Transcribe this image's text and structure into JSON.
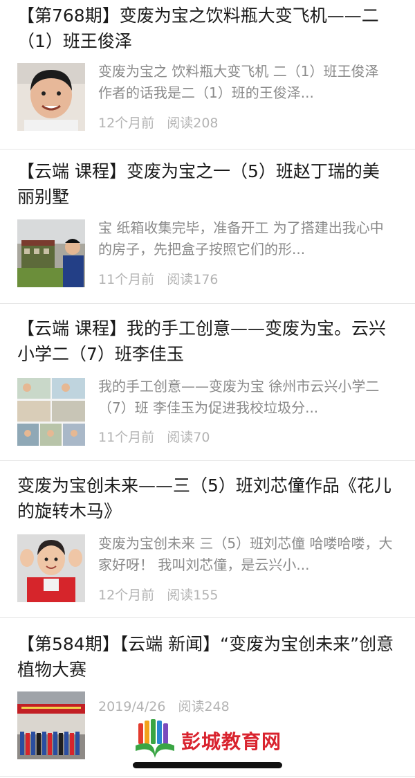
{
  "articles": [
    {
      "title": "【第768期】变废为宝之饮料瓶大变飞机——二（1）班王俊泽",
      "snippet": "变废为宝之 饮料瓶大变飞机 二（1）班王俊泽 作者的话我是二（1）班的王俊泽...",
      "time": "12个月前",
      "reads": "阅读208",
      "thumb": "boy-portrait"
    },
    {
      "title": "【云端 课程】变废为宝之一（5）班赵丁瑞的美丽别墅",
      "snippet": "宝 纸箱收集完毕，准备开工 为了搭建出我心中的房子，先把盒子按照它们的形...",
      "time": "11个月前",
      "reads": "阅读176",
      "thumb": "cardboard-house"
    },
    {
      "title": "【云端 课程】我的手工创意——变废为宝。云兴小学二（7）班李佳玉",
      "snippet": "我的手工创意——变废为宝 徐州市云兴小学二（7）班 李佳玉为促进我校垃圾分...",
      "time": "11个月前",
      "reads": "阅读70",
      "thumb": "photo-collage"
    },
    {
      "title": "变废为宝创未来——三（5）班刘芯僮作品《花儿的旋转木马》",
      "snippet": "变废为宝创未来 三（5）班刘芯僮 哈喽哈喽，大家好呀！ 我叫刘芯僮，是云兴小...",
      "time": "12个月前",
      "reads": "阅读155",
      "thumb": "girl-waving"
    },
    {
      "title": "【第584期】【云端 新闻】“变废为宝创未来”创意植物大赛",
      "time": "2019/4/26",
      "reads": "阅读248",
      "thumb": "group-photo"
    }
  ],
  "watermark": {
    "text": "彭城教育网",
    "logo": "book-logo-icon"
  },
  "colors": {
    "title": "#1a1a1a",
    "snippet": "#8a8a8a",
    "meta": "#b3b3b3",
    "divider": "#e6e6e6",
    "watermark": "#d9232e"
  }
}
